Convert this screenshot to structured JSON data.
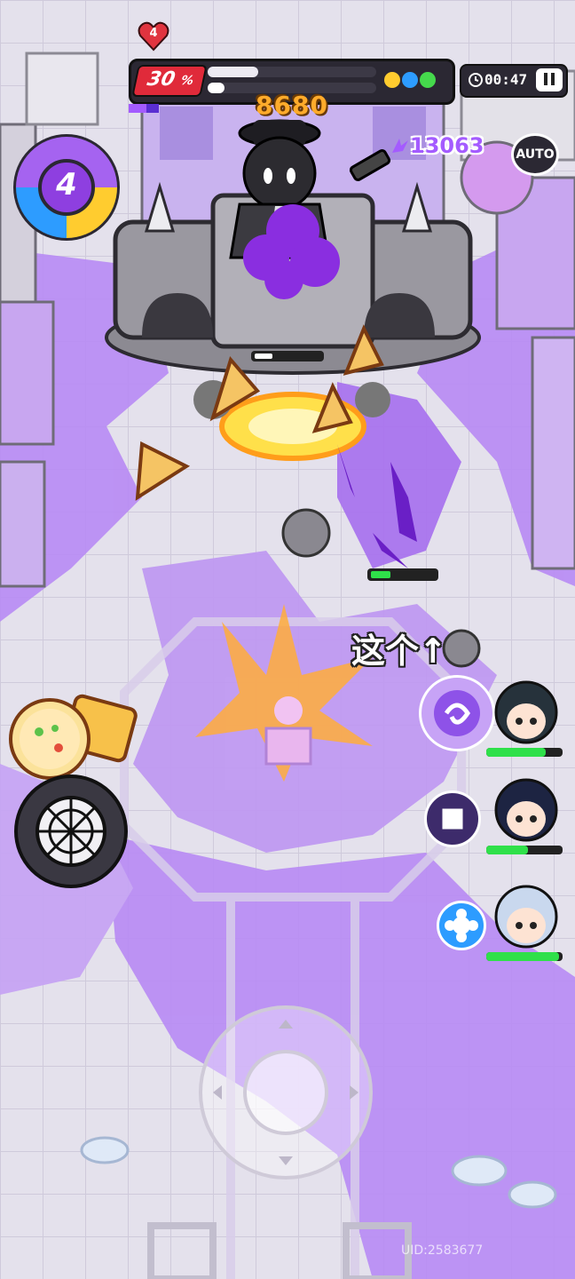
{
  "hud": {
    "wave_badge": "4",
    "boss_hp_percent_label": "30",
    "boss_hp_percent_sign": "%",
    "boss_hp_fraction": 0.3,
    "boss_hp_secondary_fraction": 0.1,
    "timer": "00:47",
    "auto_label": "AUTO",
    "combo_score": "13063",
    "damage_number": "8680",
    "level_dial_value": "4",
    "uid_text": "UID:2583677"
  },
  "annotation": {
    "text": "这个↑"
  },
  "party": {
    "members": [
      {
        "name": "dark-haired-girl",
        "hp_fraction": 0.78
      },
      {
        "name": "navy-haired-boy",
        "hp_fraction": 0.55
      },
      {
        "name": "silver-haired-girl",
        "hp_fraction": 0.95
      }
    ]
  },
  "icons": [
    "heart-flag-icon",
    "gem-cluster-icon",
    "clock-icon",
    "pause-icon",
    "auto-button",
    "pizza-icon",
    "pizza-wheel-icon",
    "virtual-joystick"
  ],
  "colors": {
    "hp_red": "#e02a3a",
    "bar_bg": "#2b2833",
    "ink_purple": "#a563f0",
    "dial_yellow": "#ffcc2f",
    "dial_blue": "#2d9cff",
    "boss_gray": "#7e7c85",
    "score_purple": "#a45bff",
    "damage_orange": "#ffab2b",
    "hp_green": "#2fe04a"
  }
}
